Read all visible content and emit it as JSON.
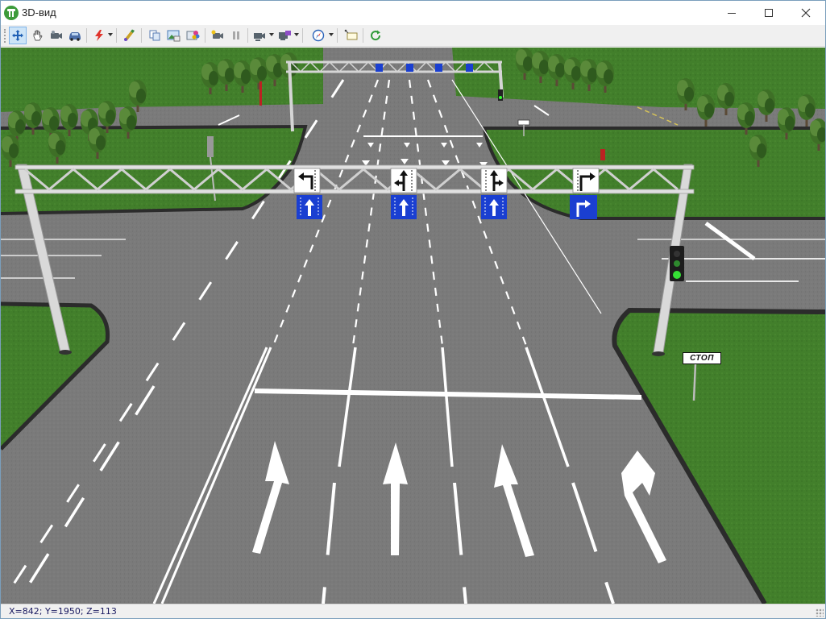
{
  "window": {
    "title": "3D-вид",
    "controls": {
      "minimize": "minimize",
      "maximize": "maximize",
      "close": "close"
    }
  },
  "toolbar": {
    "buttons": [
      {
        "icon": "move-icon",
        "active": true
      },
      {
        "icon": "hand-pan-icon"
      },
      {
        "icon": "camera-icon"
      },
      {
        "icon": "car-icon"
      },
      {
        "icon": "lightning-icon",
        "dropdown": true
      },
      {
        "icon": "paint-tool-icon"
      },
      {
        "icon": "copy-icon"
      },
      {
        "icon": "picture-icon"
      },
      {
        "icon": "palette-icon"
      },
      {
        "icon": "video-camera-icon"
      },
      {
        "icon": "pause-icon"
      },
      {
        "icon": "record-icon",
        "dropdown": true
      },
      {
        "icon": "export-icon",
        "dropdown": true
      },
      {
        "icon": "compass-icon",
        "dropdown": true
      },
      {
        "icon": "tooltip-icon"
      },
      {
        "icon": "refresh-icon"
      }
    ]
  },
  "scene": {
    "stop_sign_text": "СТОП",
    "colors": {
      "asphalt": "#757575",
      "grass": "#3f7d28",
      "sky": "#c8d2d8",
      "sign_blue": "#1a3fd1",
      "marking": "#ffffff",
      "curb": "#2b2b2b",
      "gantry": "#d9d9d9"
    }
  },
  "status": {
    "coordinates": "X=842; Y=1950; Z=113"
  }
}
